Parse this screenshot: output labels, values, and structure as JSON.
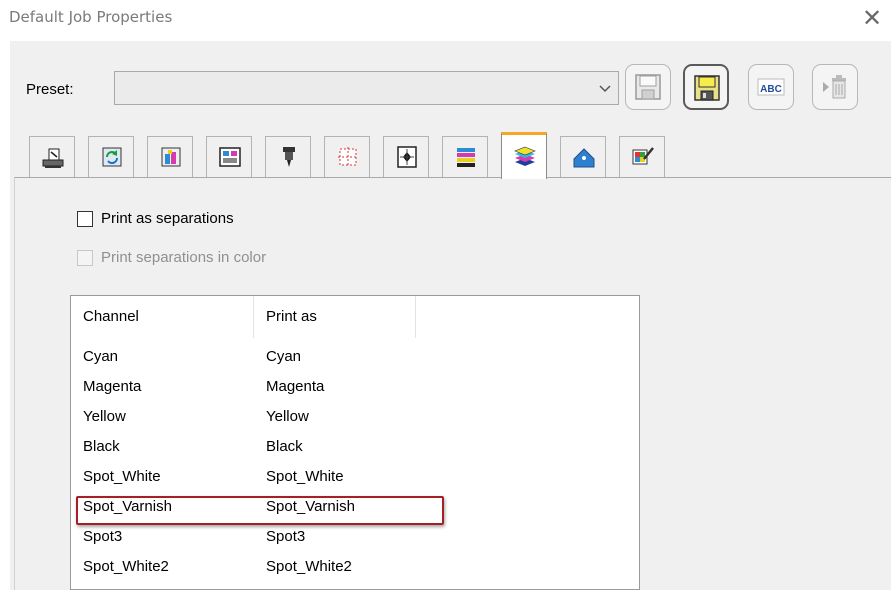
{
  "window": {
    "title": "Default Job Properties",
    "close_glyph": "✕"
  },
  "preset": {
    "label": "Preset:",
    "value": "",
    "buttons": [
      {
        "name": "save-preset-button",
        "icon": "floppy-disk-icon"
      },
      {
        "name": "save-as-preset-button",
        "icon": "floppy-disk-yellow-icon"
      },
      {
        "name": "rename-preset-button",
        "icon": "abc-rename-icon",
        "text": "ABC"
      },
      {
        "name": "delete-preset-button",
        "icon": "trash-icon"
      }
    ]
  },
  "tabs": [
    {
      "name": "tab-printer",
      "icon": "printer-icon"
    },
    {
      "name": "tab-media",
      "icon": "media-refresh-icon"
    },
    {
      "name": "tab-color",
      "icon": "color-bottle-icon"
    },
    {
      "name": "tab-layout",
      "icon": "layout-icon"
    },
    {
      "name": "tab-cutting",
      "icon": "cutter-icon"
    },
    {
      "name": "tab-marks",
      "icon": "crop-marks-icon"
    },
    {
      "name": "tab-position",
      "icon": "position-icon"
    },
    {
      "name": "tab-color-bars",
      "icon": "color-bars-icon"
    },
    {
      "name": "tab-separations",
      "icon": "layers-icon",
      "selected": true
    },
    {
      "name": "tab-tags",
      "icon": "tag-icon"
    },
    {
      "name": "tab-color-picker",
      "icon": "color-picker-icon"
    }
  ],
  "separations": {
    "print_as_separations": {
      "label": "Print as separations",
      "checked": false
    },
    "print_in_color": {
      "label": "Print separations in color",
      "checked": false,
      "disabled": true
    }
  },
  "channels_table": {
    "columns": [
      "Channel",
      "Print as"
    ],
    "rows": [
      {
        "channel": "Cyan",
        "print_as": "Cyan"
      },
      {
        "channel": "Magenta",
        "print_as": "Magenta"
      },
      {
        "channel": "Yellow",
        "print_as": "Yellow"
      },
      {
        "channel": "Black",
        "print_as": "Black"
      },
      {
        "channel": "Spot_White",
        "print_as": "Spot_White"
      },
      {
        "channel": "Spot_Varnish",
        "print_as": "Spot_Varnish",
        "highlighted": true
      },
      {
        "channel": "Spot3",
        "print_as": "Spot3"
      },
      {
        "channel": "Spot_White2",
        "print_as": "Spot_White2"
      }
    ]
  },
  "colors": {
    "highlight_border": "#a51f24",
    "selected_tab_accent": "#f5a623"
  }
}
